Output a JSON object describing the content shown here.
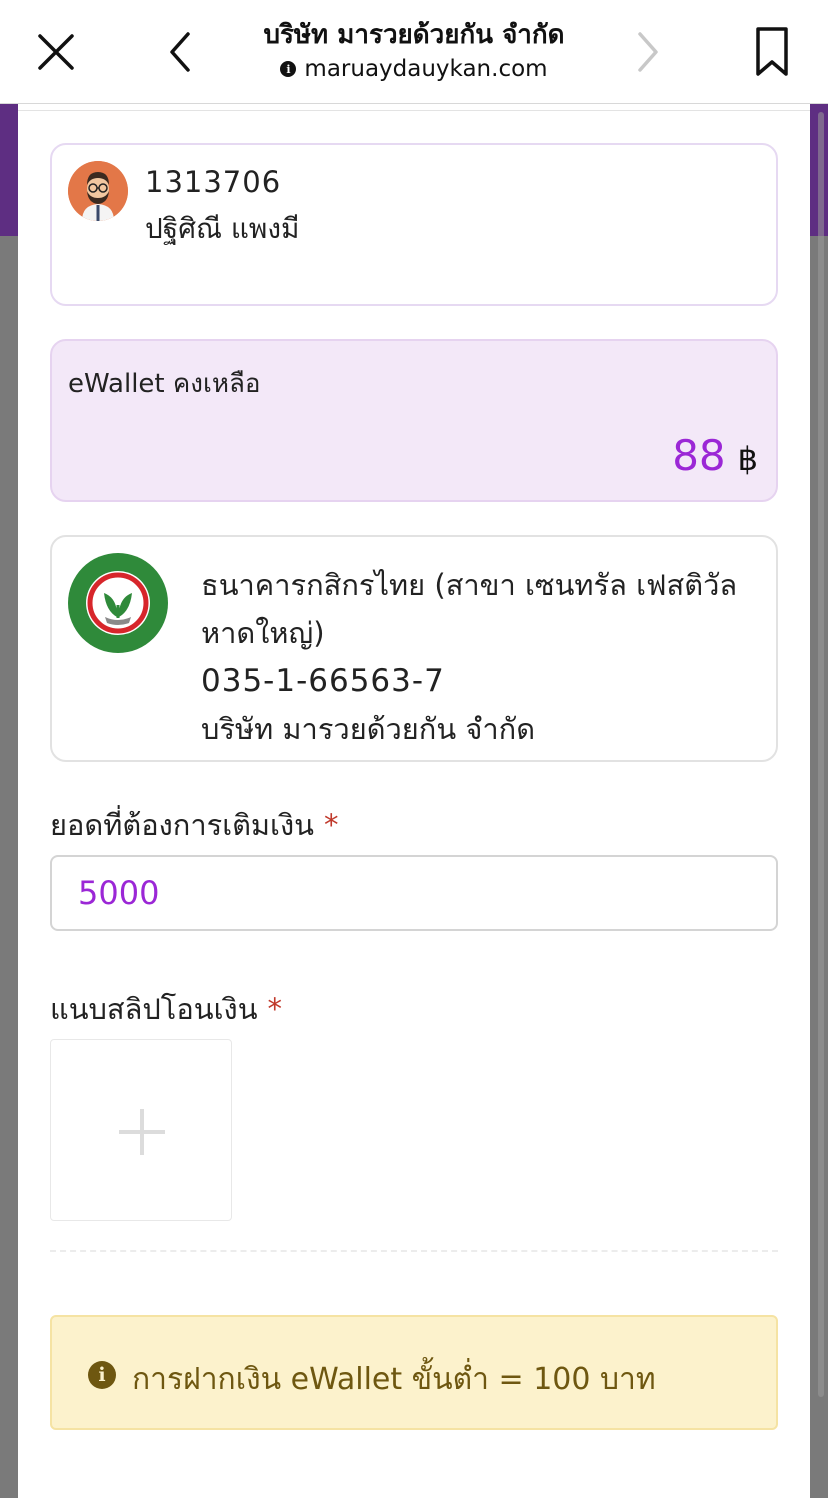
{
  "browser": {
    "title": "บริษัท มารวยด้วยกัน จำกัด",
    "url": "maruaydauykan.com",
    "icons": {
      "close": "close-icon",
      "back": "chevron-left-icon",
      "forward": "chevron-right-icon",
      "bookmark": "bookmark-icon",
      "info": "info-icon"
    }
  },
  "user": {
    "id": "1313706",
    "name": "ปฐิศิณี แพงมี",
    "avatar_icon": "avatar"
  },
  "wallet": {
    "label": "eWallet คงเหลือ",
    "amount": "88",
    "currency": "฿"
  },
  "bank": {
    "name": "ธนาคารกสิกรไทย (สาขา เซนทรัล เฟสติวัล หาดใหญ่)",
    "account_no": "035-1-66563-7",
    "holder": "บริษัท มารวยด้วยกัน จำกัด",
    "logo_icon": "kasikorn-bank-logo"
  },
  "form": {
    "amount_label": "ยอดที่ต้องการเติมเงิน",
    "amount_value": "5000",
    "slip_label": "แนบสลิปโอนเงิน",
    "required_mark": "*"
  },
  "notice": {
    "text": "การฝากเงิน eWallet ขั้นต่ำ = 100 บาท",
    "icon": "info-icon"
  },
  "colors": {
    "accent": "#9b27d6",
    "wallet_bg": "#f3e8f8",
    "notice_bg": "#fcf2cc",
    "notice_text": "#6e5710",
    "purple_header": "#5e2e82"
  }
}
